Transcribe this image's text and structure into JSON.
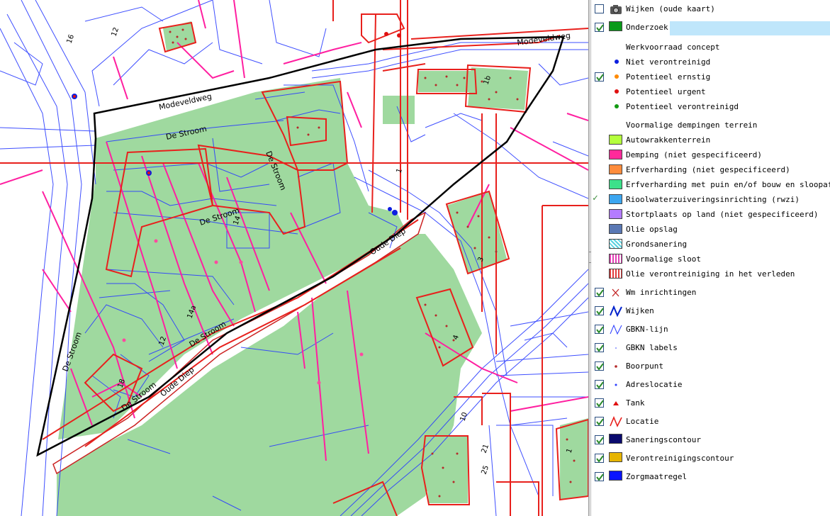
{
  "map": {
    "street_labels": {
      "mode_veld_weg_top": "Modeveldweg",
      "mode_veld_weg": "Modeveldweg",
      "de_stroom_1": "De Stroom",
      "de_stroom_2": "De Stroom",
      "de_stroom_3": "De Stroom",
      "de_stroom_4": "De Stroom",
      "de_stroom_5": "De Stroom",
      "de_stroom_6": "De Stroom",
      "oude_diep_1": "Oude Diep",
      "oude_diep_2": "Oude Diep"
    },
    "house_numbers": [
      "16",
      "12",
      "14",
      "14a",
      "12",
      "18",
      "1b",
      "3",
      "4",
      "1",
      "25",
      "21",
      "10",
      "1"
    ],
    "colors": {
      "onderzoek": "#9fd99f",
      "locatie": "#e8201c",
      "wijken": "#0022cc",
      "gbkn": "#2a3cff",
      "demping": "#ff1fa0",
      "contour": "#000000"
    }
  },
  "legend": {
    "layers": [
      {
        "label": "Wijken (oude kaart)",
        "checked": false,
        "symbol": "camera-icon"
      },
      {
        "label": "Onderzoek",
        "checked": true,
        "symbol": "green-swatch",
        "color": "#0a9a1a"
      }
    ],
    "werkvoorraad": {
      "header": "Werkvoorraad concept",
      "items": [
        {
          "label": "Niet verontreinigd",
          "color": "#0d1fe0"
        },
        {
          "label": "Potentieel ernstig",
          "color": "#ff8a00"
        },
        {
          "label": "Potentieel urgent",
          "color": "#e01010"
        },
        {
          "label": "Potentieel verontreinigd",
          "color": "#129a12"
        }
      ]
    },
    "dempingen": {
      "header": "Voormalige dempingen terrein",
      "items": [
        {
          "label": "Autowrakkenterrein",
          "color": "#b4ff3c"
        },
        {
          "label": "Demping (niet gespecificeerd)",
          "color": "#ff2a9a"
        },
        {
          "label": "Erfverharding (niet gespecificeerd)",
          "color": "#ff8c3c"
        },
        {
          "label": "Erfverharding met puin en/of bouw en sloopafval",
          "color": "#3ce08a"
        },
        {
          "label": "Rioolwaterzuiveringsinrichting (rwzi)",
          "color": "#3ca6f0"
        },
        {
          "label": "Stortplaats op land (niet gespecificeerd)",
          "color": "#b47cff"
        },
        {
          "label": "Olie opslag",
          "color": "#5a78b4"
        },
        {
          "label": "Grondsanering",
          "color": "#5ad2e0"
        },
        {
          "label": "Voormalige sloot",
          "color": "#e040b4"
        },
        {
          "label": "Olie verontreiniging in het verleden",
          "color": "#e03c3c"
        }
      ]
    },
    "layers2": [
      {
        "label": "Wm inrichtingen",
        "checked": true,
        "symbol": "x-icon"
      },
      {
        "label": "Wijken",
        "checked": true,
        "symbol": "line-blue-icon"
      },
      {
        "label": "GBKN-lijn",
        "checked": true,
        "symbol": "line-blue-thin-icon"
      },
      {
        "label": "GBKN labels",
        "checked": true,
        "symbol": "dot-small-icon"
      },
      {
        "label": "Boorpunt",
        "checked": true,
        "symbol": "boorpunt-icon"
      },
      {
        "label": "Adreslocatie",
        "checked": true,
        "symbol": "adres-icon"
      },
      {
        "label": "Tank",
        "checked": true,
        "symbol": "tank-icon"
      },
      {
        "label": "Locatie",
        "checked": true,
        "symbol": "line-red-icon"
      },
      {
        "label": "Saneringscontour",
        "checked": true,
        "symbol": "navy-swatch",
        "color": "#0a0a6e"
      },
      {
        "label": "Verontreinigingscontour",
        "checked": true,
        "symbol": "gold-swatch",
        "color": "#e6b400"
      },
      {
        "label": "Zorgmaatregel",
        "checked": true,
        "symbol": "blue-swatch",
        "color": "#0a14ff"
      }
    ]
  }
}
